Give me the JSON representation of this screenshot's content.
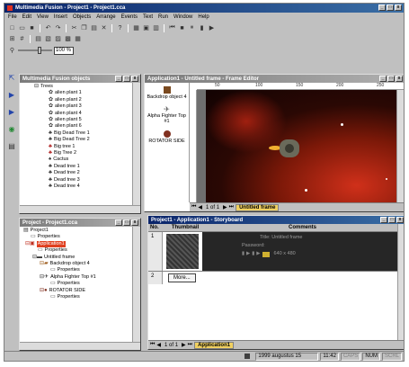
{
  "app": {
    "title": "Multimedia Fusion - Project1 - Project1.cca"
  },
  "window_buttons": [
    "_",
    "□",
    "x"
  ],
  "menu": [
    "File",
    "Edit",
    "View",
    "Insert",
    "Objects",
    "Arrange",
    "Events",
    "Text",
    "Run",
    "Window",
    "Help"
  ],
  "zoom": {
    "value": "100 %"
  },
  "objects_window": {
    "title": "Multimedia Fusion objects",
    "items": [
      "Trees",
      "alien plant 1",
      "alien plant 2",
      "alien plant 3",
      "alien plant 4",
      "alien plant 5",
      "alien plant 6",
      "Big Dead Tree 1",
      "Big Dead Tree 2",
      "Big tree 1",
      "Big Tree 2",
      "Cactus",
      "Dead tree 1",
      "Dead tree 2",
      "Dead tree 3",
      "Dead tree 4"
    ]
  },
  "frame_editor": {
    "title": "Application1 - Untitled frame - Frame Editor",
    "objects": [
      "Backdrop object 4",
      "Alpha Fighter Top #1",
      "ROTATOR SIDE"
    ],
    "ruler": [
      "50",
      "100",
      "150",
      "200",
      "250"
    ],
    "page_label": "1 of 1",
    "tab_label": "Untitled frame"
  },
  "project_window": {
    "title": "Project - Project1.cca",
    "items": [
      "Project1",
      "Properties",
      "Application1",
      "Properties",
      "Untitled frame",
      "Backdrop object 4",
      "Properties",
      "Alpha Fighter Top #1",
      "Properties",
      "ROTATOR SIDE",
      "Properties"
    ]
  },
  "storyboard": {
    "title": "Project1 - Application1 - Storyboard",
    "headers": [
      "No.",
      "Thumbnail",
      "Comments"
    ],
    "rows": [
      {
        "no": "1",
        "title": "Title: Untitled frame",
        "password": "Password:",
        "size": "640 x 480"
      },
      {
        "no": "2",
        "more": "More..."
      }
    ],
    "page_label": "1 of 1",
    "tab_label": "Application1"
  },
  "statusbar": {
    "cells": [
      "1999 augustus 15",
      "11:42",
      "CAPS",
      "NUM",
      "SCRL"
    ]
  }
}
